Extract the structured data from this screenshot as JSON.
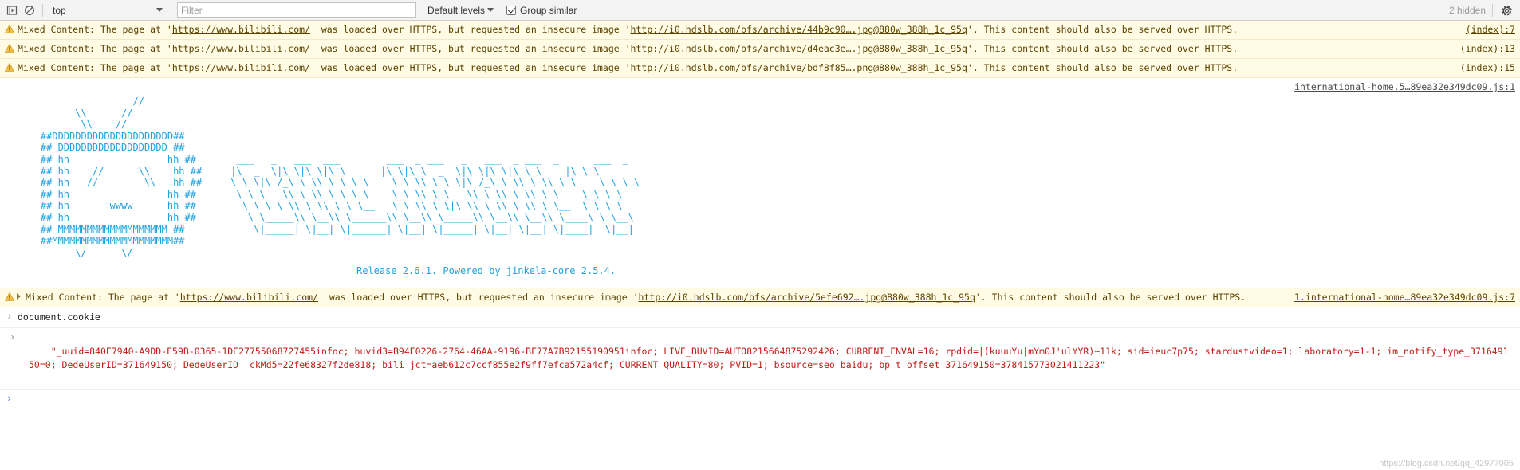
{
  "toolbar": {
    "execute_icon": "execute-snippet-icon",
    "clear_icon": "clear-console-icon",
    "context": {
      "selected": "top",
      "options": [
        "top"
      ]
    },
    "filter": {
      "placeholder": "Filter",
      "value": ""
    },
    "levels": {
      "label": "Default levels"
    },
    "group_similar": {
      "label": "Group similar",
      "checked": true
    },
    "hidden_count": "2 hidden",
    "settings_icon": "gear-icon"
  },
  "messages": [
    {
      "level": "warning",
      "icon": "warning-triangle-icon",
      "text_before_page_url": "Mixed Content: The page at '",
      "page_url": "https://www.bilibili.com/",
      "text_middle": "' was loaded over HTTPS, but requested an insecure image '",
      "image_url": "http://i0.hdslb.com/bfs/archive/44b9c90….jpg@880w_388h_1c_95q",
      "text_after": "'. This content should also be served over HTTPS.",
      "source": "(index):7",
      "expandable": false
    },
    {
      "level": "warning",
      "icon": "warning-triangle-icon",
      "text_before_page_url": "Mixed Content: The page at '",
      "page_url": "https://www.bilibili.com/",
      "text_middle": "' was loaded over HTTPS, but requested an insecure image '",
      "image_url": "http://i0.hdslb.com/bfs/archive/d4eac3e….jpg@880w_388h_1c_95q",
      "text_after": "'. This content should also be served over HTTPS.",
      "source": "(index):13",
      "expandable": false
    },
    {
      "level": "warning",
      "icon": "warning-triangle-icon",
      "text_before_page_url": "Mixed Content: The page at '",
      "page_url": "https://www.bilibili.com/",
      "text_middle": "' was loaded over HTTPS, but requested an insecure image '",
      "image_url": "http://i0.hdslb.com/bfs/archive/bdf8f85….png@880w_388h_1c_95q",
      "text_after": "'. This content should also be served over HTTPS.",
      "source": "(index):15",
      "expandable": false
    }
  ],
  "banner": {
    "source": "international-home.5…89ea32e349dc09.js:1",
    "ascii_art": "                    //\n          \\\\      //\n           \\\\    //\n    ##DDDDDDDDDDDDDDDDDDDDD##\n    ## DDDDDDDDDDDDDDDDDDD ##\n    ## hh                 hh ##\n    ## hh    //      \\\\    hh ##\n    ## hh   //        \\\\   hh ##\n    ## hh                 hh ##\n    ## hh       wwww      hh ##\n    ## hh                 hh ##\n    ## MMMMMMMMMMMMMMMMMMM ##\n    ##MMMMMMMMMMMMMMMMMMMMM##\n          \\/      \\/",
    "ascii_word_art": "  ___   _   ___  ___        ___  _ ___   _   ___  _ ___  _      ___  _\n |\\  _  \\|\\ \\|\\ \\|\\ \\      |\\ \\|\\ \\  _  \\|\\ \\|\\ \\|\\ \\ \\    |\\ \\ \\\n \\ \\ \\|\\ /_\\ \\ \\\\ \\ \\ \\ \\    \\ \\ \\\\ \\ \\ \\|\\ /_\\ \\ \\\\ \\ \\\\ \\ \\    \\ \\ \\ \\\n  \\ \\ \\   \\\\ \\ \\\\ \\ \\ \\ \\    \\ \\ \\\\ \\ \\   \\\\ \\ \\\\ \\ \\\\ \\ \\    \\ \\ \\ \\\n   \\ \\ \\|\\ \\\\ \\ \\\\ \\ \\ \\__   \\ \\ \\\\ \\ \\|\\ \\\\ \\ \\\\ \\ \\\\ \\ \\__  \\ \\ \\ \\\n    \\ \\_____\\\\ \\__\\\\ \\______\\\\ \\__\\\\ \\_____\\\\ \\__\\\\ \\__\\\\ \\____\\ \\ \\__\\\n     \\|_____| \\|__| \\|______| \\|__| \\|_____| \\|__| \\|__| \\|____|  \\|__|",
    "release_line": "Release 2.6.1. Powered by jinkela-core 2.5.4."
  },
  "last_warning": {
    "level": "warning",
    "icon": "warning-triangle-icon",
    "expandable": true,
    "text_before_page_url": "Mixed Content: The page at '",
    "page_url": "https://www.bilibili.com/",
    "text_middle": "' was loaded over HTTPS, but requested an insecure image '",
    "image_url": "http://i0.hdslb.com/bfs/archive/5efe692….jpg@880w_388h_1c_95q",
    "text_after": "'. This content should also be served over HTTPS.",
    "source": "1.international-home…89ea32e349dc09.js:7"
  },
  "command": {
    "prompt_glyph": "›",
    "text": "document.cookie"
  },
  "result": {
    "prompt_glyph": "‹",
    "text": "\"_uuid=840E7940-A9DD-E59B-0365-1DE27755068727455infoc; buvid3=B94E0226-2764-46AA-9196-BF77A7B92155190951infoc; LIVE_BUVID=AUTO8215664875292426; CURRENT_FNVAL=16; rpdid=|(kuuuYu|mYm0J'ulYYR)~11k; sid=ieuc7p75; stardustvideo=1; laboratory=1-1; im_notify_type_371649150=0; DedeUserID=371649150; DedeUserID__ckMd5=22fe68327f2de818; bili_jct=aeb612c7ccf855e2f9ff7efca572a4cf; CURRENT_QUALITY=80; PVID=1; bsource=seo_baidu; bp_t_offset_371649150=378415773021411223\""
  },
  "input_prompt": {
    "prompt_glyph": "›",
    "value": ""
  },
  "watermark": "https://blog.csdn.net/qq_42977005",
  "colors": {
    "warning_bg": "#fffbe5",
    "warning_text": "#5c4400",
    "ascii_blue": "#1fa2e0",
    "result_red": "#c41a16",
    "toolbar_bg": "#f3f3f3"
  }
}
